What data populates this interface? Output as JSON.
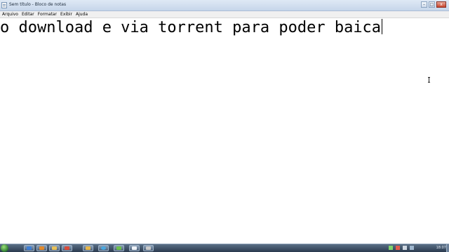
{
  "window": {
    "title": "Sem título - Bloco de notas",
    "controls": {
      "minimize": "–",
      "maximize": "□",
      "close": "x"
    }
  },
  "menu": {
    "items": [
      "Arquivo",
      "Editar",
      "Formatar",
      "Exibir",
      "Ajuda"
    ]
  },
  "editor": {
    "content": "o download e via torrent para poder baica"
  },
  "taskbar": {
    "clock": "18:07",
    "colors": {
      "accent": "#2a3a4e",
      "start": "#2c7a2f"
    }
  }
}
